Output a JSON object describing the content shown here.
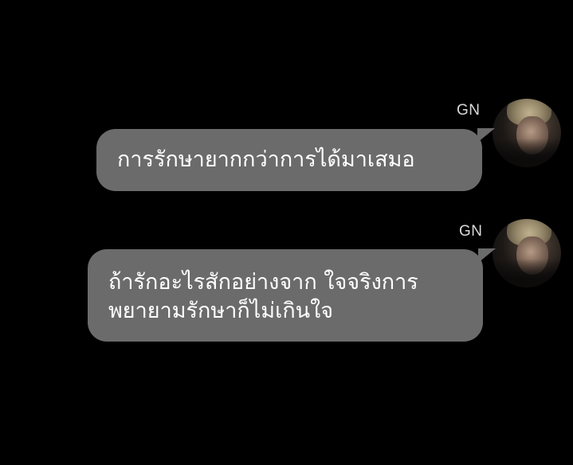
{
  "messages": [
    {
      "sender": "GN",
      "text": "การรักษายากกว่าการได้มาเสมอ"
    },
    {
      "sender": "GN",
      "text": "ถ้ารักอะไรสักอย่างจาก ใจจริงการ\nพยายามรักษาก็ไม่เกินใจ"
    }
  ],
  "colors": {
    "background": "#000000",
    "bubble": "#6b6b6b",
    "bubble_text": "#ffffff",
    "sender_name": "#d9d9d9"
  }
}
